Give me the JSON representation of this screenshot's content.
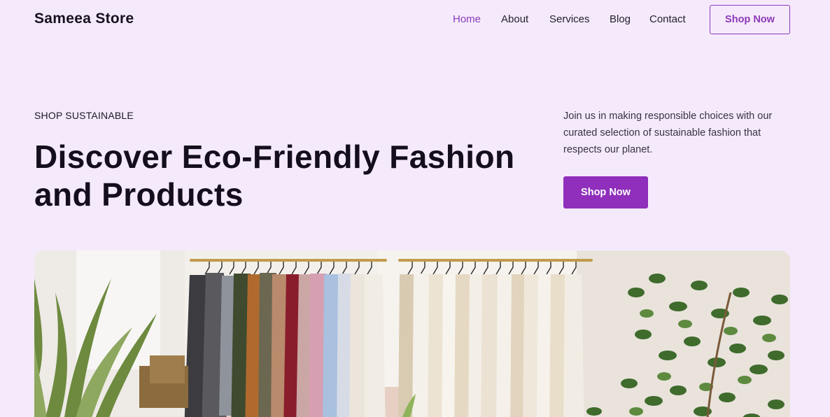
{
  "header": {
    "brand": "Sameea Store",
    "nav": [
      {
        "label": "Home",
        "active": true
      },
      {
        "label": "About",
        "active": false
      },
      {
        "label": "Services",
        "active": false
      },
      {
        "label": "Blog",
        "active": false
      },
      {
        "label": "Contact",
        "active": false
      }
    ],
    "cta_label": "Shop Now"
  },
  "hero": {
    "eyebrow": "SHOP SUSTAINABLE",
    "headline": "Discover Eco-Friendly Fashion and Products",
    "description": "Join us in making responsible choices with our curated selection of sustainable fashion that respects our planet.",
    "cta_label": "Shop Now",
    "image_subject": "clothing-rack-with-plants"
  },
  "colors": {
    "background": "#f5eafc",
    "accent": "#8f2fbb",
    "text": "#140e1d",
    "nav_active": "#8a3bb9"
  }
}
